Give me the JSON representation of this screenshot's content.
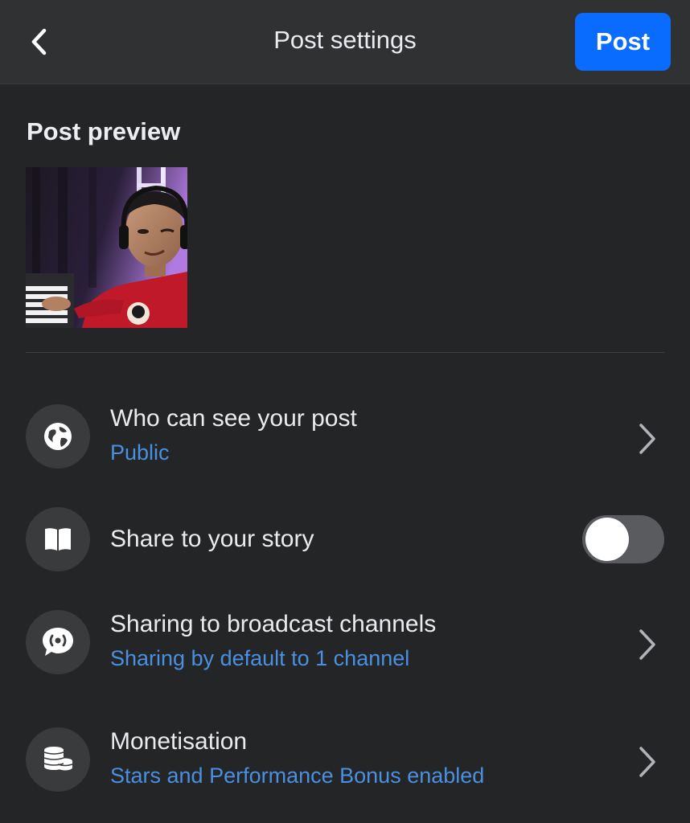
{
  "header": {
    "title": "Post settings",
    "post_label": "Post"
  },
  "preview": {
    "title": "Post preview"
  },
  "settings": {
    "audience": {
      "title": "Who can see your post",
      "value": "Public",
      "icon": "globe-icon"
    },
    "story": {
      "title": "Share to your story",
      "enabled": false,
      "icon": "book-icon"
    },
    "broadcast": {
      "title": "Sharing to broadcast channels",
      "value": "Sharing by default to 1 channel",
      "icon": "broadcast-icon"
    },
    "monetisation": {
      "title": "Monetisation",
      "value": "Stars and Performance Bonus enabled",
      "icon": "coins-icon"
    }
  },
  "colors": {
    "background": "#242526",
    "header": "#303133",
    "accent": "#0a6cff",
    "link": "#4a90e2"
  }
}
